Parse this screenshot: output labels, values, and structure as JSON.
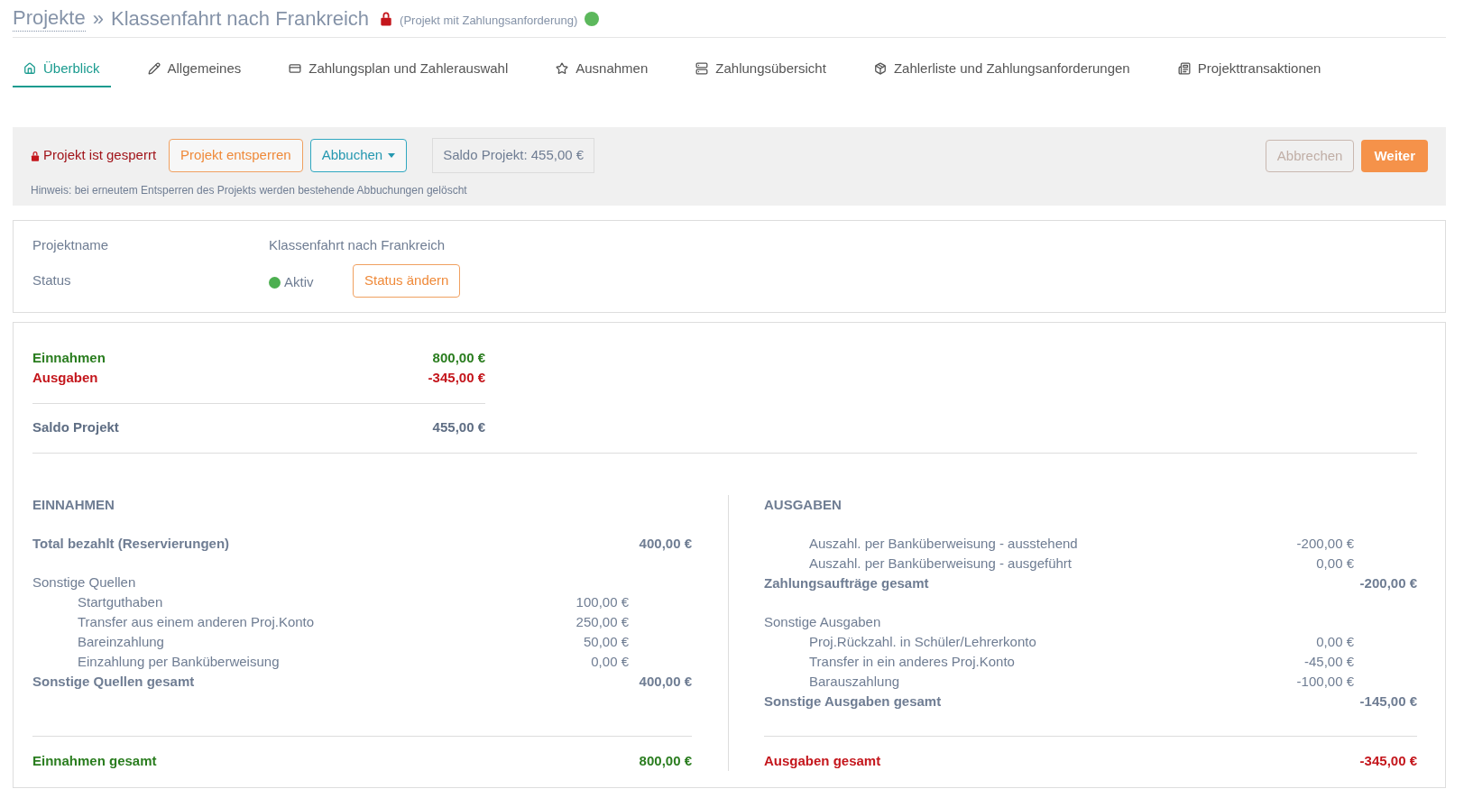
{
  "breadcrumb": {
    "root": "Projekte",
    "separator": "»",
    "title": "Klassenfahrt nach Frankreich",
    "locked": true,
    "note": "(Projekt mit Zahlungsanforderung)",
    "active": true
  },
  "tabs": [
    {
      "label": "Überblick",
      "selected": true
    },
    {
      "label": "Allgemeines",
      "selected": false
    },
    {
      "label": "Zahlungsplan und Zahlerauswahl",
      "selected": false
    },
    {
      "label": "Ausnahmen",
      "selected": false
    },
    {
      "label": "Zahlungsübersicht",
      "selected": false
    },
    {
      "label": "Zahlerliste und Zahlungsanforderungen",
      "selected": false
    },
    {
      "label": "Projekttransaktionen",
      "selected": false
    }
  ],
  "toolbar": {
    "lock_label": "Projekt ist gesperrt",
    "unlock_button": "Projekt entsperren",
    "book_button": "Abbuchen",
    "balance": "Saldo Projekt: 455,00 €",
    "hint": "Hinweis: bei erneutem Entsperren des Projekts werden bestehende Abbuchungen gelöscht",
    "cancel": {
      "label": "Abbrechen",
      "disabled": true
    },
    "next": {
      "label": "Weiter",
      "disabled": false
    }
  },
  "info": {
    "name_label": "Projektname",
    "name_value": "Klassenfahrt nach Frankreich",
    "status_label": "Status",
    "status_value": "Aktiv",
    "status_active": true,
    "status_button": "Status ändern"
  },
  "summary": [
    {
      "kind": "income",
      "label": "Einnahmen",
      "value": "800,00 €"
    },
    {
      "kind": "expense",
      "label": "Ausgaben",
      "value": "-345,00 €"
    },
    {
      "kind": "balance",
      "label": "Saldo Projekt",
      "value": "455,00 €"
    }
  ],
  "columns": [
    {
      "heading": "EINNAHMEN",
      "lines": [
        {
          "kind": "total",
          "label": "Total bezahlt (Reservierungen)",
          "value": "400,00 €"
        },
        {
          "kind": "gap"
        },
        {
          "kind": "group",
          "label": "Sonstige Quellen"
        },
        {
          "kind": "item",
          "label": "Startguthaben",
          "value": "100,00 €"
        },
        {
          "kind": "item",
          "label": "Transfer aus einem anderen Proj.Konto",
          "value": "250,00 €"
        },
        {
          "kind": "item",
          "label": "Bareinzahlung",
          "value": "50,00 €"
        },
        {
          "kind": "item",
          "label": "Einzahlung per Banküberweisung",
          "value": "0,00 €"
        },
        {
          "kind": "total",
          "label": "Sonstige Quellen gesamt",
          "value": "400,00 €"
        }
      ],
      "grand": {
        "kind": "income",
        "label": "Einnahmen gesamt",
        "value": "800,00 €"
      }
    },
    {
      "heading": "AUSGABEN",
      "lines": [
        {
          "kind": "item",
          "label": "Auszahl. per Banküberweisung - ausstehend",
          "value": "-200,00 €"
        },
        {
          "kind": "item",
          "label": "Auszahl. per Banküberweisung - ausgeführt",
          "value": "0,00 €"
        },
        {
          "kind": "total",
          "label": "Zahlungsaufträge gesamt",
          "value": "-200,00 €"
        },
        {
          "kind": "gap"
        },
        {
          "kind": "group",
          "label": "Sonstige Ausgaben"
        },
        {
          "kind": "item",
          "label": "Proj.Rückzahl. in Schüler/Lehrerkonto",
          "value": "0,00 €"
        },
        {
          "kind": "item",
          "label": "Transfer in ein anderes Proj.Konto",
          "value": "-45,00 €"
        },
        {
          "kind": "item",
          "label": "Barauszahlung",
          "value": "-100,00 €"
        },
        {
          "kind": "total",
          "label": "Sonstige Ausgaben gesamt",
          "value": "-145,00 €"
        }
      ],
      "grand": {
        "kind": "expense",
        "label": "Ausgaben gesamt",
        "value": "-345,00 €"
      }
    }
  ]
}
